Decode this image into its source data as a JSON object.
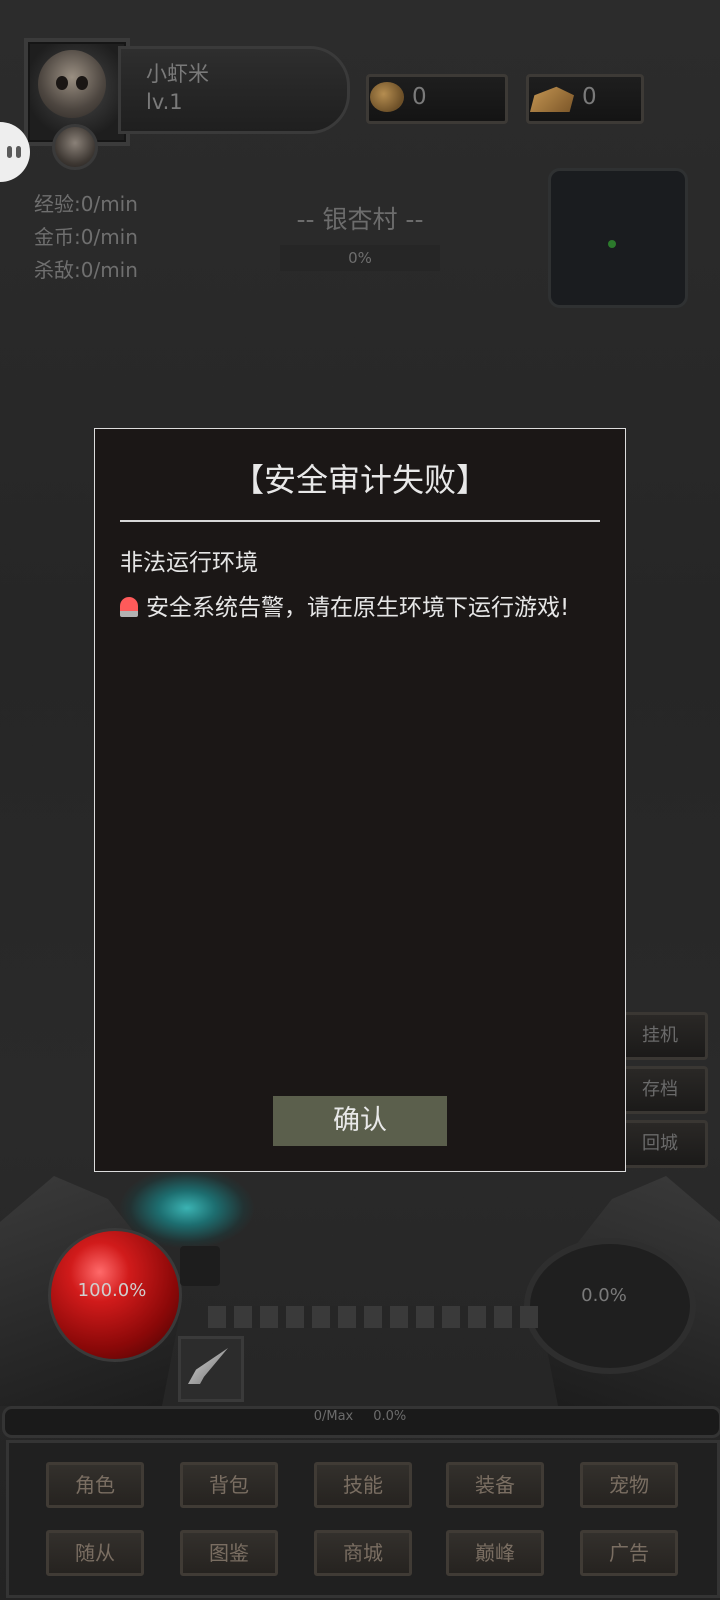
{
  "header": {
    "player_name": "小虾米",
    "player_level": "lv.1",
    "coins": "0",
    "gold": "0"
  },
  "stats": {
    "exp_rate": "经验:0/min",
    "gold_rate": "金币:0/min",
    "kill_rate": "杀敌:0/min"
  },
  "map": {
    "name": "-- 银杏村 --",
    "progress": "0%"
  },
  "side_buttons": [
    "挂机",
    "存档",
    "回城"
  ],
  "hud": {
    "hp": "100.0%",
    "mp": "0.0%",
    "exp_amount": "0/Max",
    "exp_percent": "0.0%"
  },
  "nav": {
    "row1": [
      "角色",
      "背包",
      "技能",
      "装备",
      "宠物"
    ],
    "row2": [
      "随从",
      "图鉴",
      "商城",
      "巅峰",
      "广告"
    ]
  },
  "dialog": {
    "title": "【安全审计失败】",
    "subtitle": "非法运行环境",
    "message": "安全系统告警，请在原生环境下运行游戏!",
    "confirm": "确认"
  },
  "colors": {
    "hp_orb": "#d11b1b",
    "confirm_button": "#5b5f4c",
    "dialog_bg": "#1b1716"
  }
}
